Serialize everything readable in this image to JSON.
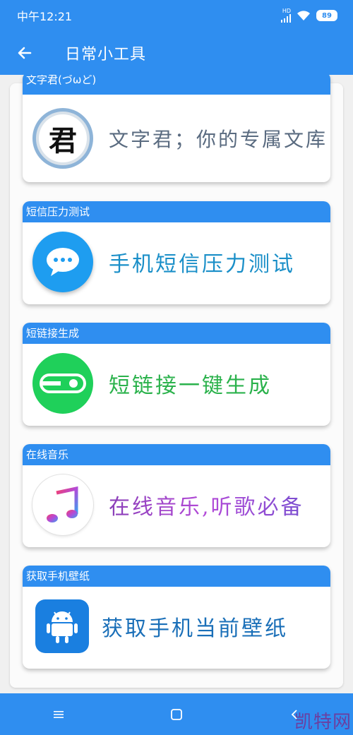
{
  "status": {
    "time": "中午12:21",
    "network": "HD",
    "battery": "89"
  },
  "appbar": {
    "title": "日常小工具"
  },
  "cards": [
    {
      "header": "文字君(づωど)",
      "text": "文字君；你的专属文库",
      "logo_char": "君",
      "text_color": "#5a6b80"
    },
    {
      "header": "短信压力测试",
      "text": "手机短信压力测试",
      "text_color": "#1a8fc8"
    },
    {
      "header": "短链接生成",
      "text": "短链接一键生成",
      "text_color": "#2bb24c"
    },
    {
      "header": "在线音乐",
      "text": "在线音乐,听歌必备",
      "text_color": "#8a3fb8"
    },
    {
      "header": "获取手机壁纸",
      "text": "获取手机当前壁纸",
      "text_color": "#1a6fb8"
    }
  ],
  "watermark": "凯特网",
  "colors": {
    "primary": "#2f8ef0",
    "green": "#1fd05a",
    "chat_blue": "#1e9df0",
    "android_blue": "#1a7fe0"
  }
}
